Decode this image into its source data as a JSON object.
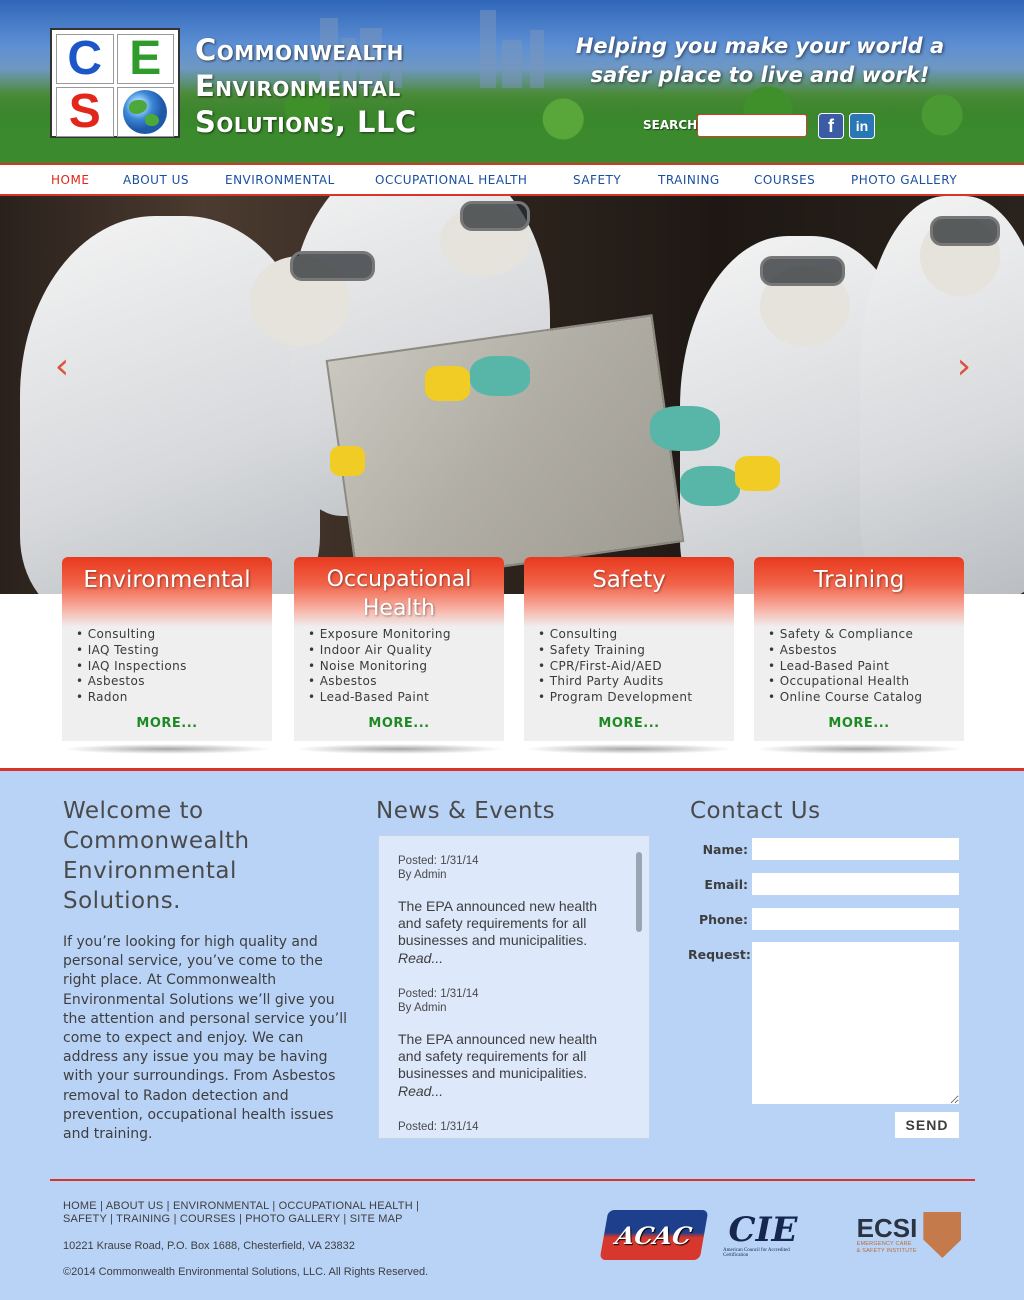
{
  "header": {
    "logo_letters": [
      "C",
      "E",
      "S"
    ],
    "company_name_lines": [
      "Commonwealth",
      "Environmental",
      "Solutions, LLC"
    ],
    "tagline_lines": [
      "Helping you make your world a",
      "safer place to live and work!"
    ],
    "search_label": "SEARCH",
    "search_value": "",
    "social": [
      {
        "name": "facebook-icon",
        "glyph": "f"
      },
      {
        "name": "linkedin-icon",
        "glyph": "in"
      }
    ]
  },
  "nav": {
    "items": [
      {
        "label": "HOME",
        "active": true
      },
      {
        "label": "ABOUT US",
        "active": false
      },
      {
        "label": "ENVIRONMENTAL",
        "active": false
      },
      {
        "label": "OCCUPATIONAL HEALTH",
        "active": false
      },
      {
        "label": "SAFETY",
        "active": false
      },
      {
        "label": "TRAINING",
        "active": false
      },
      {
        "label": "COURSES",
        "active": false
      },
      {
        "label": "PHOTO GALLERY",
        "active": false
      }
    ]
  },
  "hero": {
    "prev_arrow": "‹",
    "next_arrow": "›"
  },
  "cards": [
    {
      "title": "Environmental",
      "items": [
        "Consulting",
        "IAQ Testing",
        "IAQ Inspections",
        "Asbestos",
        "Radon"
      ],
      "more": "MORE..."
    },
    {
      "title": "Occupational Health",
      "items": [
        "Exposure Monitoring",
        "Indoor Air Quality",
        "Noise Monitoring",
        "Asbestos",
        "Lead-Based Paint"
      ],
      "more": "MORE..."
    },
    {
      "title": "Safety",
      "items": [
        "Consulting",
        "Safety Training",
        "CPR/First-Aid/AED",
        "Third Party Audits",
        "Program Development"
      ],
      "more": "MORE..."
    },
    {
      "title": "Training",
      "items": [
        "Safety & Compliance",
        "Asbestos",
        "Lead-Based Paint",
        "Occupational Health",
        "Online Course Catalog"
      ],
      "more": "MORE..."
    }
  ],
  "welcome": {
    "title_lines": [
      "Welcome to",
      "Commonwealth",
      "Environmental",
      "Solutions."
    ],
    "body": "If you’re looking for high quality and personal service, you’ve come to the right place. At Commonwealth Environmental Solutions we’ll give you the attention and personal service you’ll come to expect and enjoy. We can address any issue you may be having with your surroundings. From Asbestos removal to Radon detection and prevention, occupational health issues and training."
  },
  "news": {
    "title": "News & Events",
    "items": [
      {
        "posted": "Posted: 1/31/14",
        "by": "By Admin",
        "body": "The EPA announced new health and safety requirements for all businesses and municipalities.",
        "read": "Read..."
      },
      {
        "posted": "Posted: 1/31/14",
        "by": "By Admin",
        "body": "The EPA announced new health and safety requirements for all businesses and municipalities.",
        "read": "Read..."
      },
      {
        "posted": "Posted: 1/31/14",
        "by": "",
        "body": "",
        "read": ""
      }
    ]
  },
  "contact": {
    "title": "Contact Us",
    "name_label": "Name:",
    "email_label": "Email:",
    "phone_label": "Phone:",
    "request_label": "Request:",
    "send_label": "SEND"
  },
  "footer": {
    "links_line1": "HOME | ABOUT US | ENVIRONMENTAL | OCCUPATIONAL HEALTH |",
    "links_line2": "SAFETY | TRAINING | COURSES | PHOTO GALLERY | SITE MAP",
    "address": "10221 Krause Road, P.O. Box 1688, Chesterfield, VA 23832",
    "copyright": "©2014 Commonwealth Environmental Solutions, LLC. All Rights Reserved.",
    "badges": {
      "acac": "ACAC",
      "cie": "CIE",
      "cie_sub": "American Council for Accredited Certification",
      "ecsi": "ECSI",
      "ecsi_sub1": "EMERGENCY CARE",
      "ecsi_sub2": "& SAFETY INSTITUTE"
    }
  },
  "colors": {
    "accent_red": "#d9332a",
    "nav_blue": "#1a4fa0",
    "more_green": "#1e8a23",
    "content_bg": "#b9d3f7"
  }
}
